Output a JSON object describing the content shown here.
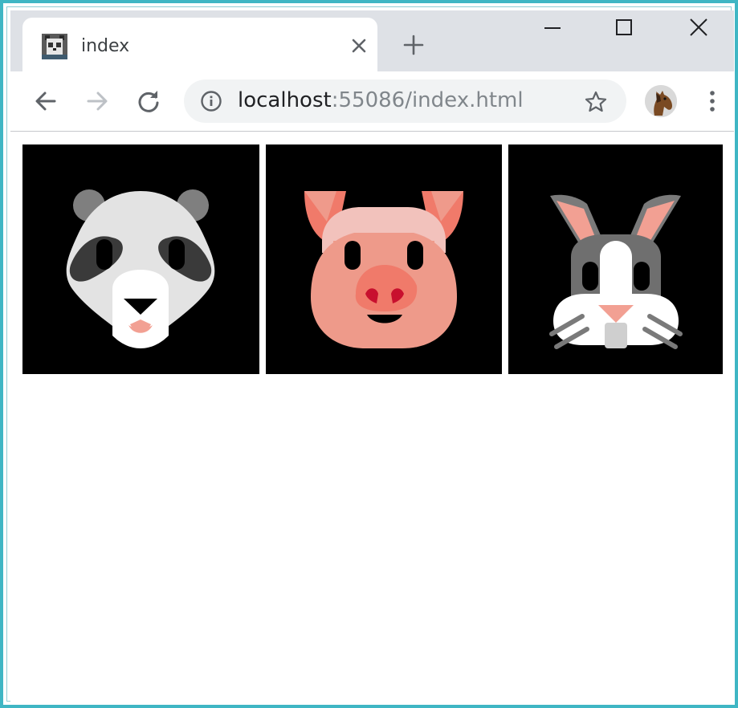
{
  "browser": {
    "tab": {
      "title": "index",
      "favicon": "panda-favicon"
    },
    "toolbar": {
      "url_host": "localhost",
      "url_rest": ":55086/index.html"
    },
    "icons": {
      "back": "back-arrow-icon",
      "forward": "forward-arrow-icon",
      "reload": "reload-icon",
      "site_info": "info-icon",
      "bookmark": "star-icon",
      "profile": "horse-avatar",
      "menu": "three-dots-icon"
    }
  },
  "page": {
    "images": [
      {
        "name": "panda",
        "icon": "panda-face-icon"
      },
      {
        "name": "pig",
        "icon": "pig-face-icon"
      },
      {
        "name": "rabbit",
        "icon": "rabbit-face-icon"
      }
    ]
  },
  "colors": {
    "window_border": "#3fb6c4",
    "tab_strip": "#dee1e6",
    "omnibox": "#f1f3f4",
    "tile_background": "#000000"
  }
}
